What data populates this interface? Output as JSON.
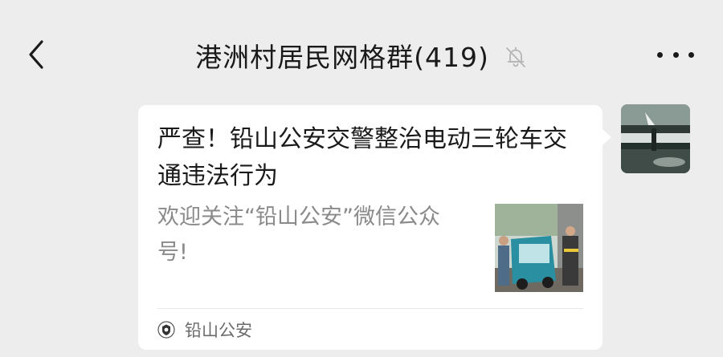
{
  "header": {
    "title": "港洲村居民网格群(419)",
    "back_icon": "chevron-left-icon",
    "mute_icon": "bell-off-icon",
    "more_icon": "ellipsis-icon"
  },
  "message": {
    "title": "严查！铅山公安交警整治电动三轮车交通违法行为",
    "description": "欢迎关注“铅山公安”微信公众号!",
    "source_name": "铅山公安",
    "thumbnail_icon": "article-photo",
    "source_icon": "police-badge-icon"
  },
  "colors": {
    "background": "#ededed",
    "card": "#ffffff",
    "title_text": "#1a1a1a",
    "desc_text": "#8a8a8a"
  }
}
